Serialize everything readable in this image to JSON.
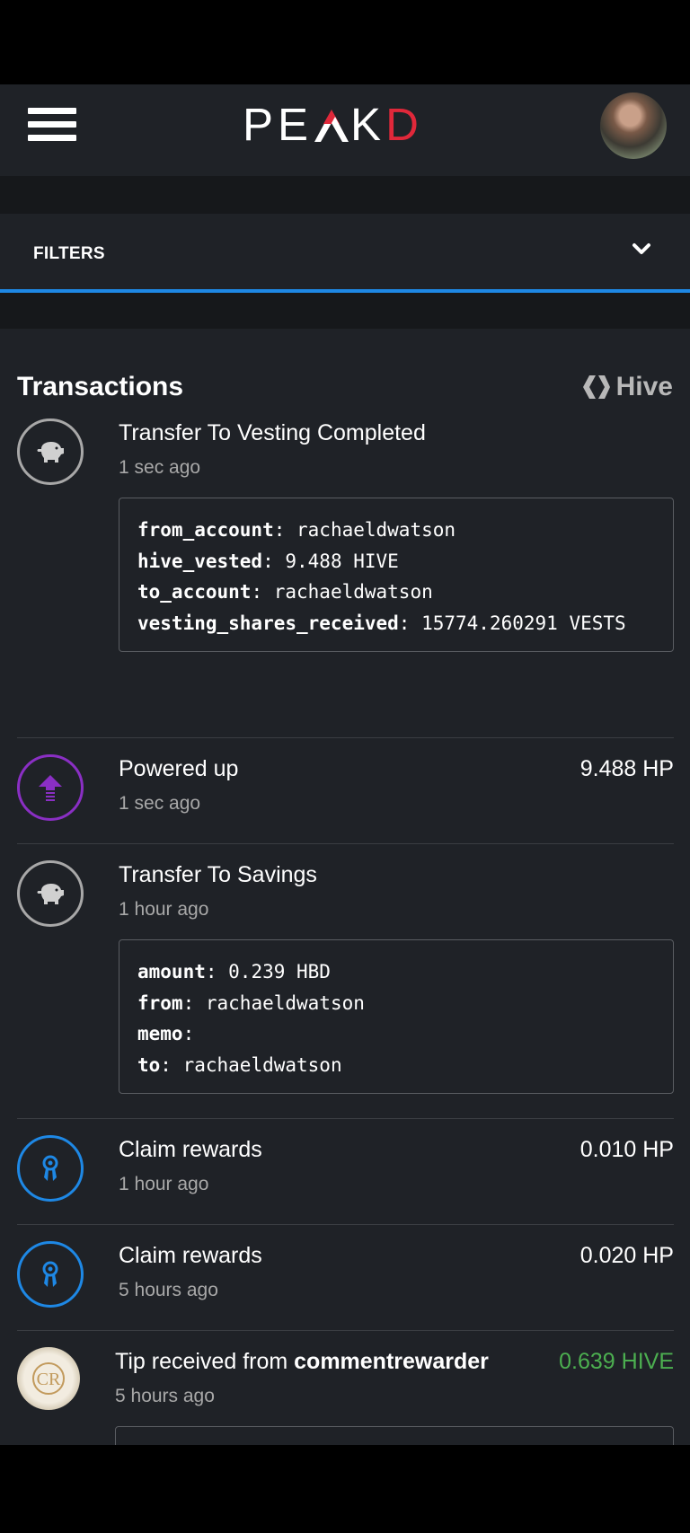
{
  "header": {
    "logo_text": "PEAKD",
    "brand_color": "#e0283a",
    "menu_icon": "hamburger-menu-icon",
    "avatar_icon": "user-avatar"
  },
  "filters": {
    "label": "FILTERS",
    "icon": "chevron-down-icon",
    "accent_color": "#1e88e5"
  },
  "transactions": {
    "title": "Transactions",
    "chain_label": "Hive",
    "items": [
      {
        "icon": "piggy-bank-icon",
        "title": "Transfer To Vesting Completed",
        "time": "1 sec ago",
        "details": [
          {
            "key": "from_account",
            "value": "rachaeldwatson"
          },
          {
            "key": "hive_vested",
            "value": "9.488 HIVE"
          },
          {
            "key": "to_account",
            "value": "rachaeldwatson"
          },
          {
            "key": "vesting_shares_received",
            "value": "15774.260291 VESTS"
          }
        ]
      },
      {
        "icon": "power-up-arrow-icon",
        "title": "Powered up",
        "time": "1 sec ago",
        "amount": "9.488 HP"
      },
      {
        "icon": "piggy-bank-icon",
        "title": "Transfer To Savings",
        "time": "1 hour ago",
        "details": [
          {
            "key": "amount",
            "value": "0.239 HBD"
          },
          {
            "key": "from",
            "value": "rachaeldwatson"
          },
          {
            "key": "memo",
            "value": ""
          },
          {
            "key": "to",
            "value": "rachaeldwatson"
          }
        ]
      },
      {
        "icon": "award-ribbon-icon",
        "title": "Claim rewards",
        "time": "1 hour ago",
        "amount": "0.010 HP"
      },
      {
        "icon": "award-ribbon-icon",
        "title": "Claim rewards",
        "time": "5 hours ago",
        "amount": "0.020 HP"
      },
      {
        "icon": "commentrewarder-logo",
        "title_prefix": "Tip received from",
        "title_user": "commentrewarder",
        "time": "5 hours ago",
        "amount": "0.639 HIVE",
        "amount_color": "#4caf50"
      }
    ]
  }
}
